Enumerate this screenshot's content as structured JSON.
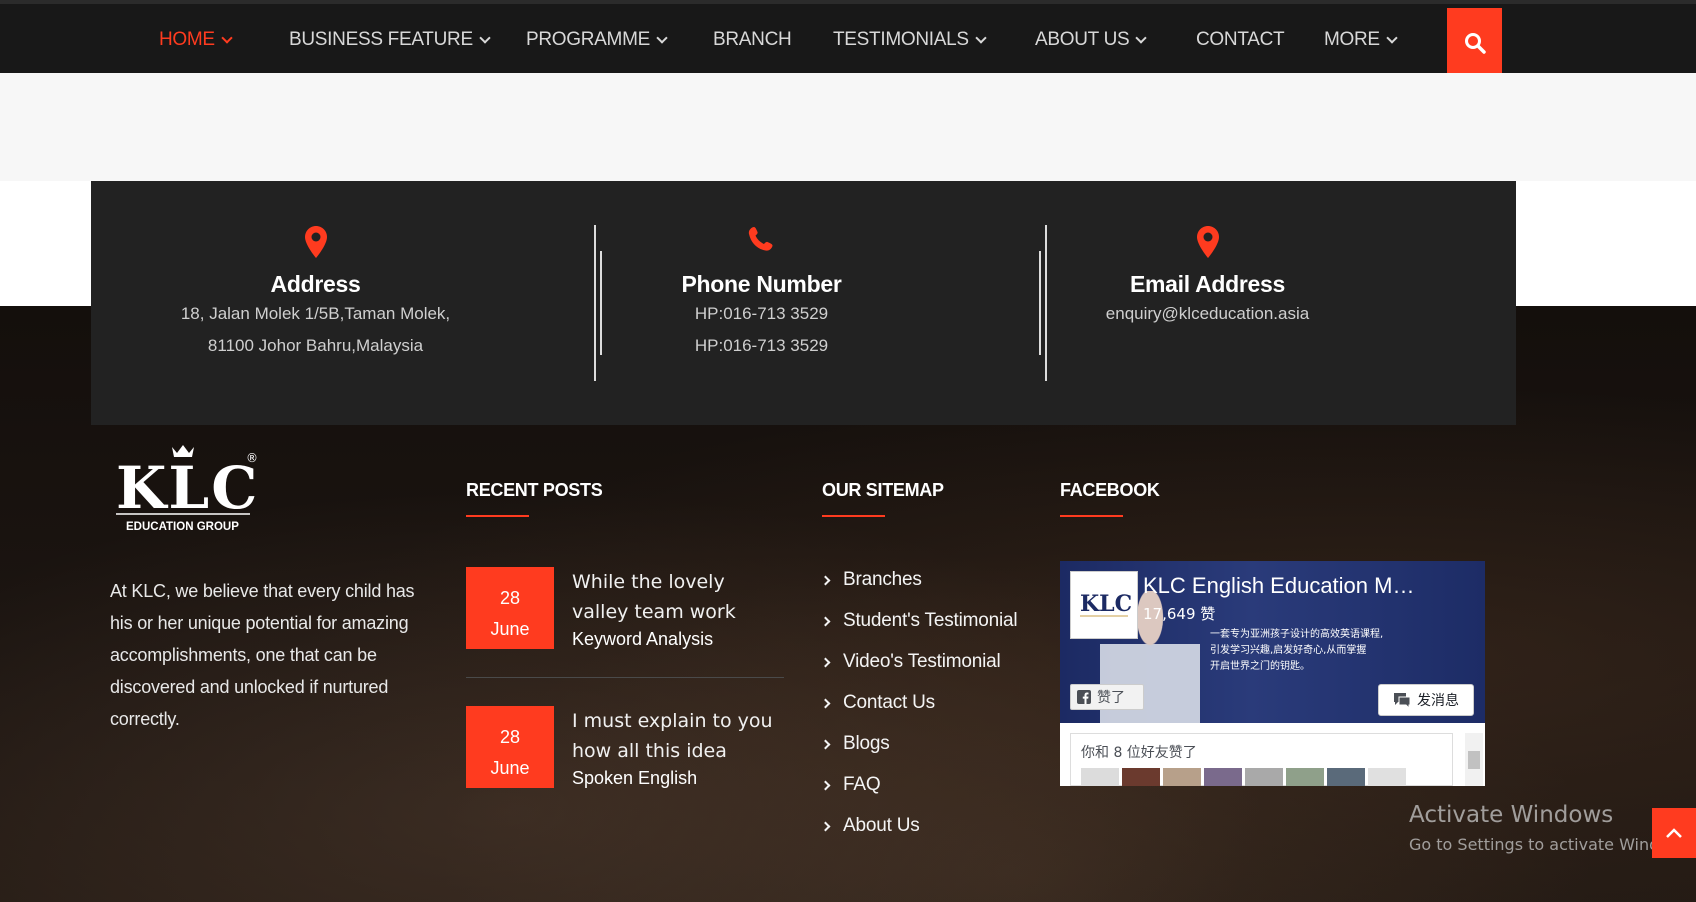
{
  "colors": {
    "accent": "#ff3b1f",
    "nav_bg": "#181818",
    "contact_bg": "#222222"
  },
  "nav": {
    "items": [
      {
        "label": "HOME",
        "has_dropdown": true,
        "active": true
      },
      {
        "label": "BUSINESS FEATURE",
        "has_dropdown": true
      },
      {
        "label": "PROGRAMME",
        "has_dropdown": true
      },
      {
        "label": "BRANCH",
        "has_dropdown": false
      },
      {
        "label": "TESTIMONIALS",
        "has_dropdown": true
      },
      {
        "label": "ABOUT US",
        "has_dropdown": true
      },
      {
        "label": "CONTACT",
        "has_dropdown": false
      },
      {
        "label": "MORE",
        "has_dropdown": true
      }
    ],
    "search_icon": "search-icon"
  },
  "contact": {
    "address": {
      "icon": "map-marker-icon",
      "title": "Address",
      "lines": [
        "18, Jalan Molek 1/5B,Taman Molek,",
        "81100 Johor Bahru,Malaysia"
      ]
    },
    "phone": {
      "icon": "phone-icon",
      "title": "Phone Number",
      "lines": [
        "HP:016-713 3529",
        "HP:016-713 3529"
      ]
    },
    "email": {
      "icon": "map-marker-icon",
      "title": "Email Address",
      "lines": [
        "enquiry@klceducation.asia"
      ]
    }
  },
  "footer": {
    "logo": {
      "text": "KLC",
      "subtitle": "EDUCATION GROUP",
      "mark": "®"
    },
    "about_text": "At KLC, we believe that every child has his or her unique potential for amazing accomplishments, one that can be discovered and unlocked if nurtured correctly.",
    "recent_posts": {
      "title": "RECENT POSTS",
      "posts": [
        {
          "day": "28",
          "month": "June",
          "title": "While the lovely valley team work",
          "category": "Keyword Analysis"
        },
        {
          "day": "28",
          "month": "June",
          "title": "I must explain to you how all this idea",
          "category": "Spoken English"
        }
      ]
    },
    "sitemap": {
      "title": "OUR SITEMAP",
      "items": [
        "Branches",
        "Student's Testimonial",
        "Video's Testimonial",
        "Contact Us",
        "Blogs",
        "FAQ",
        "About Us"
      ]
    },
    "facebook": {
      "title": "FACEBOOK",
      "page_name": "KLC English Education M…",
      "likes": "17,649 赞",
      "slogan": [
        "一套专为亚洲孩子设计的高效英语课程,",
        "引发学习兴趣,启发好奇心,从而掌握",
        "开启世界之门的钥匙。"
      ],
      "like_button": "赞了",
      "message_button": "发消息",
      "friends_text": "你和 8 位好友赞了"
    }
  },
  "windows_watermark": {
    "line1": "Activate Windows",
    "line2": "Go to Settings to activate Windows."
  },
  "back_to_top_icon": "chevron-up-icon"
}
